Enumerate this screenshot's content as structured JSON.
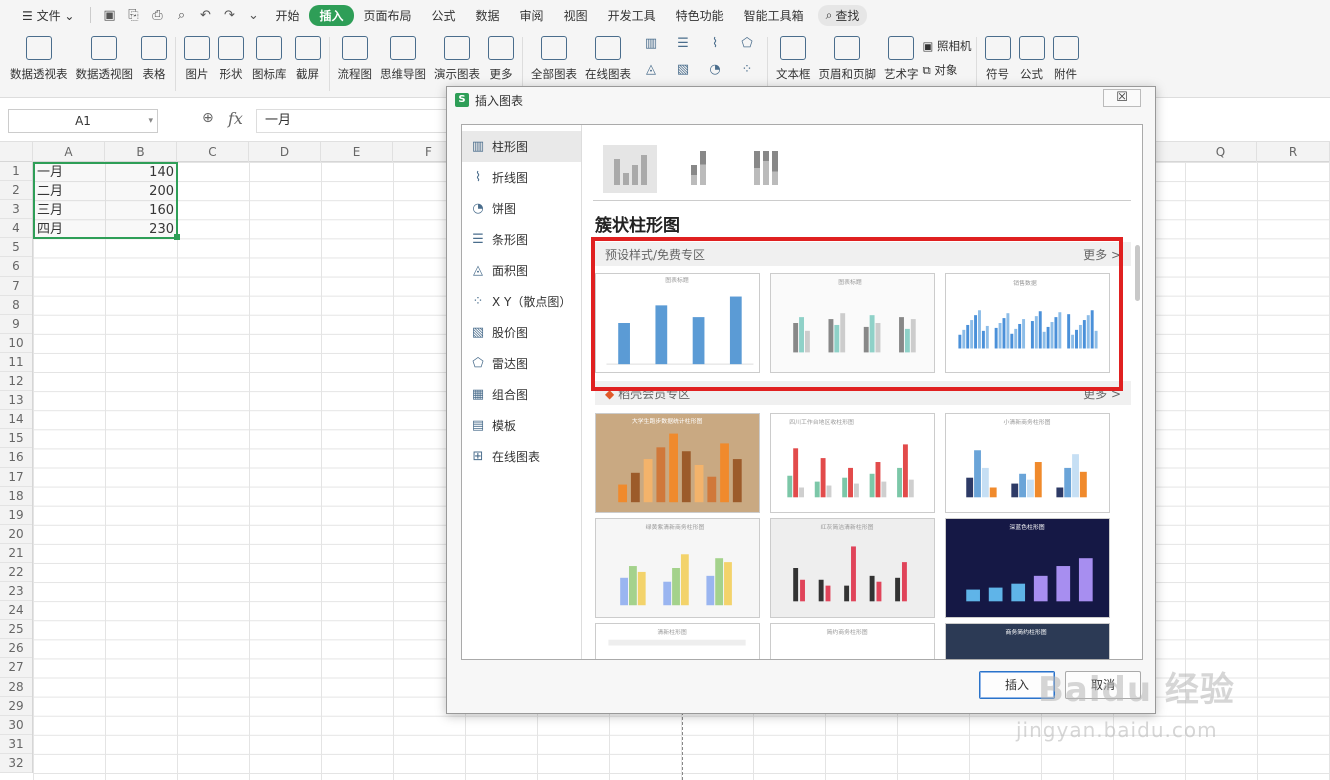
{
  "menubar": {
    "file": "文件",
    "tabs": [
      "开始",
      "插入",
      "页面布局",
      "公式",
      "数据",
      "审阅",
      "视图",
      "开发工具",
      "特色功能",
      "智能工具箱"
    ],
    "active_tab": "插入",
    "search": "查找"
  },
  "ribbon": {
    "items": [
      "数据透视表",
      "数据透视图",
      "表格",
      "图片",
      "形状",
      "图标库",
      "截屏",
      "流程图",
      "思维导图",
      "演示图表",
      "更多",
      "全部图表",
      "在线图表",
      "文本框",
      "页眉和页脚",
      "艺术字",
      "符号",
      "公式",
      "附件"
    ],
    "camera": "照相机",
    "object": "对象"
  },
  "formula_bar": {
    "cell_ref": "A1",
    "fx": "fx",
    "value": "一月"
  },
  "sheet": {
    "columns": [
      "A",
      "B",
      "C",
      "D",
      "E",
      "F",
      "Q",
      "R"
    ],
    "rows": [
      "1",
      "2",
      "3",
      "4",
      "5",
      "6",
      "7",
      "8",
      "9",
      "10",
      "11",
      "12",
      "13",
      "14",
      "15",
      "16",
      "17",
      "18",
      "19",
      "20",
      "21",
      "22",
      "23",
      "24",
      "25",
      "26",
      "27",
      "28",
      "29",
      "30",
      "31",
      "32"
    ],
    "data": [
      {
        "a": "一月",
        "b": "140"
      },
      {
        "a": "二月",
        "b": "200"
      },
      {
        "a": "三月",
        "b": "160"
      },
      {
        "a": "四月",
        "b": "230"
      }
    ]
  },
  "dialog": {
    "title": "插入图表",
    "close": "☒",
    "categories": [
      {
        "label": "柱形图",
        "icon": "column-chart-icon"
      },
      {
        "label": "折线图",
        "icon": "line-chart-icon"
      },
      {
        "label": "饼图",
        "icon": "pie-chart-icon"
      },
      {
        "label": "条形图",
        "icon": "bar-chart-icon"
      },
      {
        "label": "面积图",
        "icon": "area-chart-icon"
      },
      {
        "label": "X Y（散点图）",
        "icon": "scatter-chart-icon"
      },
      {
        "label": "股价图",
        "icon": "stock-chart-icon"
      },
      {
        "label": "雷达图",
        "icon": "radar-chart-icon"
      },
      {
        "label": "组合图",
        "icon": "combo-chart-icon"
      },
      {
        "label": "模板",
        "icon": "template-icon"
      },
      {
        "label": "在线图表",
        "icon": "online-chart-icon"
      }
    ],
    "active_category": "柱形图",
    "section_title": "簇状柱形图",
    "preset_zone": "预设样式/免费专区",
    "preset_more": "更多 >",
    "member_zone": "稻壳会员专区",
    "member_more": "更多 >",
    "insert": "插入",
    "cancel": "取消"
  },
  "thumbs": {
    "preset": [
      "图表标题",
      "图表标题",
      "销售数据"
    ],
    "member": [
      "大学生跑步数据统计柱形图",
      "四川工作台地区收柱形图",
      "小清新商务柱形图",
      "绿黄紫清新商务柱形图",
      "红灰简洁清新柱形图",
      "深蓝色柱形图",
      "清新柱形图",
      "简约商务柱形图",
      "商务简约柱形图"
    ]
  },
  "watermark": {
    "main": "Baidu 经验",
    "sub": "jingyan.baidu.com"
  },
  "colors": {
    "accent": "#2e9e57",
    "highlight": "#e02020",
    "bar_blue": "#5b9bd5"
  }
}
